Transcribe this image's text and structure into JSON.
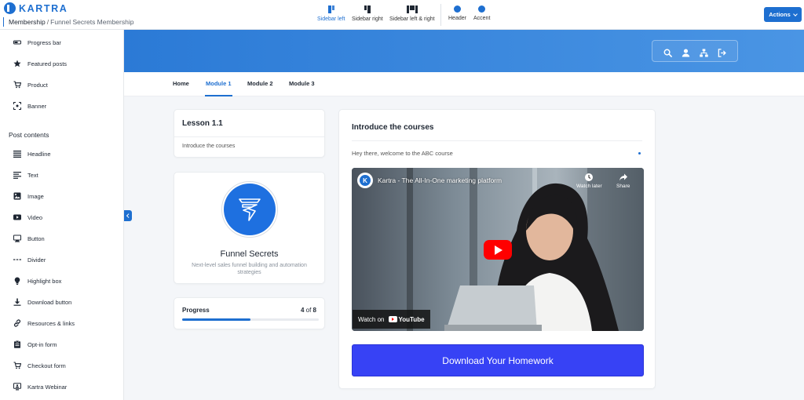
{
  "app": {
    "brand": "KARTRA",
    "breadcrumb": {
      "root": "Membership",
      "separator": "/",
      "current": "Funnel Secrets Membership"
    }
  },
  "layout_options": [
    {
      "label": "Sidebar left",
      "active": true
    },
    {
      "label": "Sidebar right",
      "active": false
    },
    {
      "label": "Sidebar left & right",
      "active": false
    },
    {
      "label": "Header",
      "active": false
    },
    {
      "label": "Accent",
      "active": false
    }
  ],
  "actions": {
    "label": "Actions"
  },
  "sidebar": {
    "top_items": [
      {
        "label": "Progress bar",
        "icon": "progress-bar-icon"
      },
      {
        "label": "Featured posts",
        "icon": "star-icon"
      },
      {
        "label": "Product",
        "icon": "cart-icon"
      },
      {
        "label": "Banner",
        "icon": "banner-icon"
      }
    ],
    "section_title": "Post contents",
    "items": [
      {
        "label": "Headline",
        "icon": "headline-icon"
      },
      {
        "label": "Text",
        "icon": "text-icon"
      },
      {
        "label": "Image",
        "icon": "image-icon"
      },
      {
        "label": "Video",
        "icon": "video-icon"
      },
      {
        "label": "Button",
        "icon": "button-icon"
      },
      {
        "label": "Divider",
        "icon": "divider-icon"
      },
      {
        "label": "Highlight box",
        "icon": "lightbulb-icon"
      },
      {
        "label": "Download button",
        "icon": "download-icon"
      },
      {
        "label": "Resources & links",
        "icon": "link-icon"
      },
      {
        "label": "Opt-in form",
        "icon": "clipboard-icon"
      },
      {
        "label": "Checkout form",
        "icon": "cart-icon"
      },
      {
        "label": "Kartra Webinar",
        "icon": "webinar-icon"
      }
    ]
  },
  "tabs": [
    {
      "label": "Home",
      "active": false
    },
    {
      "label": "Module 1",
      "active": true
    },
    {
      "label": "Module 2",
      "active": false
    },
    {
      "label": "Module 3",
      "active": false
    }
  ],
  "lesson": {
    "title": "Lesson 1.1",
    "subtitle": "Introduce the courses"
  },
  "brand_card": {
    "name": "Funnel Secrets",
    "description": "Next-level sales funnel building and automation strategies"
  },
  "progress": {
    "label": "Progress",
    "current": 4,
    "of_label": "of",
    "total": 8
  },
  "content": {
    "title": "Introduce the courses",
    "subtitle": "Hey there, welcome to the ABC course",
    "video": {
      "channel_initial": "K",
      "title": "Kartra - The All-In-One marketing platform",
      "watch_later": "Watch later",
      "share": "Share",
      "watch_on": "Watch on",
      "platform": "YouTube"
    },
    "download_button": "Download Your Homework"
  },
  "colors": {
    "accent": "#1e6fd0",
    "download_button": "#3742f5",
    "play_button": "#ff0000"
  }
}
